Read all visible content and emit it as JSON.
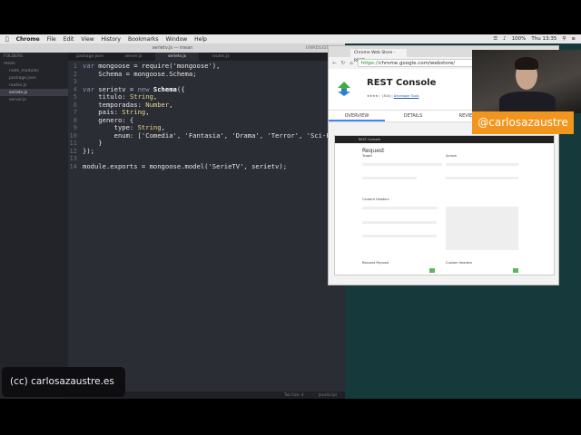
{
  "menubar": {
    "apple": "",
    "app": "Chrome",
    "items": [
      "File",
      "Edit",
      "View",
      "History",
      "Bookmarks",
      "Window",
      "Help"
    ],
    "battery": "100%",
    "clock": "Thu 13:35"
  },
  "editor": {
    "title": "serietv.js — mean",
    "unregistered": "UNREGISTERED",
    "sidebar": {
      "header": "FOLDERS",
      "items": [
        "mean",
        "node_modules",
        "package.json",
        "routes.js",
        "serietv.js",
        "server.js"
      ],
      "selected": "serietv.js"
    },
    "tabs": [
      "package.json",
      "server.js",
      "serietv.js",
      "routes.js"
    ],
    "active_tab": "serietv.js",
    "code": [
      "var mongoose = require('mongoose'),",
      "    Schema = mongoose.Schema;",
      "",
      "var serietv = new Schema({",
      "    titulo: String,",
      "    temporadas: Number,",
      "    pais: String,",
      "    genero: {",
      "        type: String,",
      "        enum: ['Comedia', 'Fantasia', 'Drama', 'Terror', 'Sci-Fi",
      "    }",
      "});",
      "",
      "module.exports = mongoose.model('SerieTV', serietv);"
    ],
    "status": {
      "tab_size": "Tab Size: 4",
      "syntax": "JavaScript"
    }
  },
  "chrome": {
    "tab_title": "Chrome Web Store - REST",
    "url_scheme": "https://",
    "url_rest": "chrome.google.com/webstore/",
    "extension": {
      "name": "REST Console",
      "rating_count": "(300)",
      "category": "Developer Tools"
    },
    "store_tabs": [
      "OVERVIEW",
      "DETAILS",
      "REVIEWS"
    ],
    "active_store_tab": "OVERVIEW",
    "screenshot": {
      "app_name": "REST Console",
      "heading": "Request",
      "sections": [
        "Target",
        "Accept",
        "Content Headers",
        "Request Payload",
        "Custom Headers"
      ]
    }
  },
  "overlay": {
    "handle": "@carlosazaustre",
    "credit": "(cc) carlosazaustre.es",
    "handle_bg": "#f2951d"
  }
}
